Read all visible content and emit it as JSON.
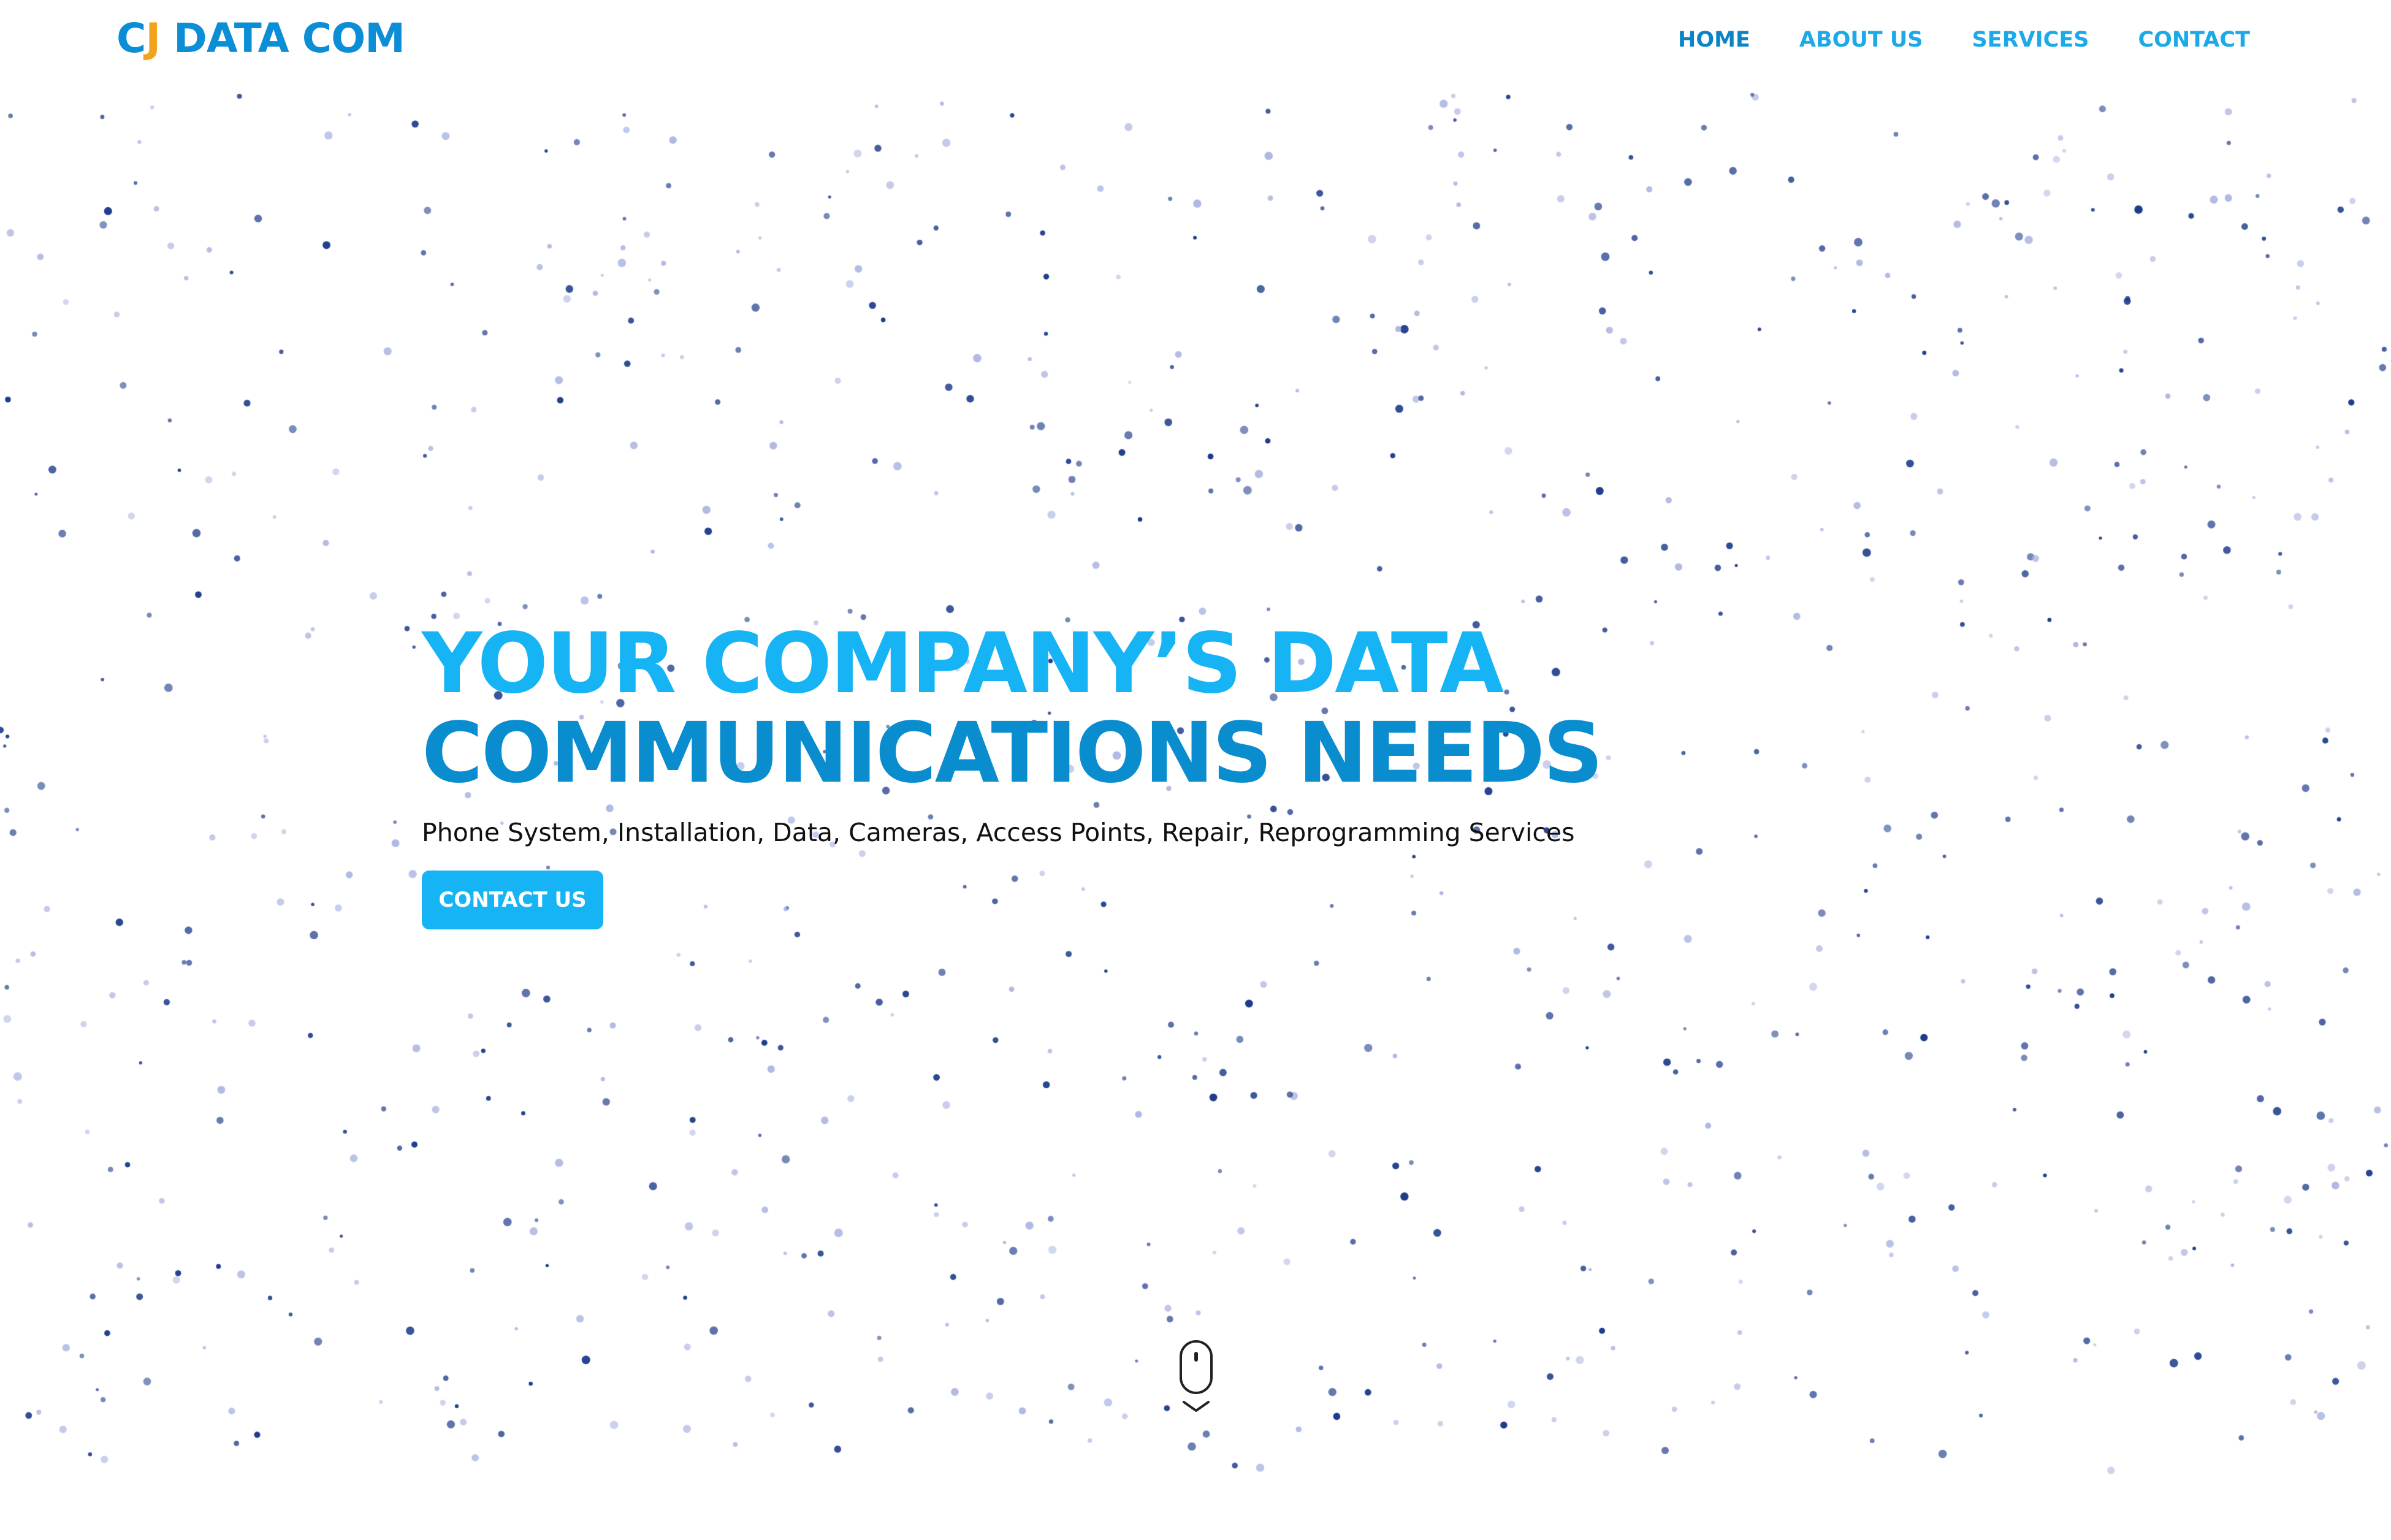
{
  "brand": {
    "logo_c": "C",
    "logo_j": "J",
    "logo_rest": "DATA COM",
    "colors": {
      "logo_blue": "#0b8ed6",
      "logo_orange": "#f2a31b",
      "accent": "#16b4f4",
      "accent_dark": "#0a8dcf",
      "dot_dark": "#1d3b8a",
      "dot_light": "#a7b0e0"
    }
  },
  "nav": {
    "items": [
      {
        "label": "HOME",
        "active": true
      },
      {
        "label": "ABOUT US",
        "active": false
      },
      {
        "label": "SERVICES",
        "active": false
      },
      {
        "label": "CONTACT",
        "active": false
      }
    ]
  },
  "hero": {
    "title_line1": "YOUR COMPANY’S DATA",
    "title_line2": "COMMUNICATIONS NEEDS",
    "subtitle": "Phone System, Installation, Data, Cameras, Access Points, Repair, Reprogramming Services",
    "cta_label": "CONTACT US"
  },
  "icons": {
    "scroll": "mouse-scroll-icon",
    "chevron": "chevron-down-icon"
  }
}
